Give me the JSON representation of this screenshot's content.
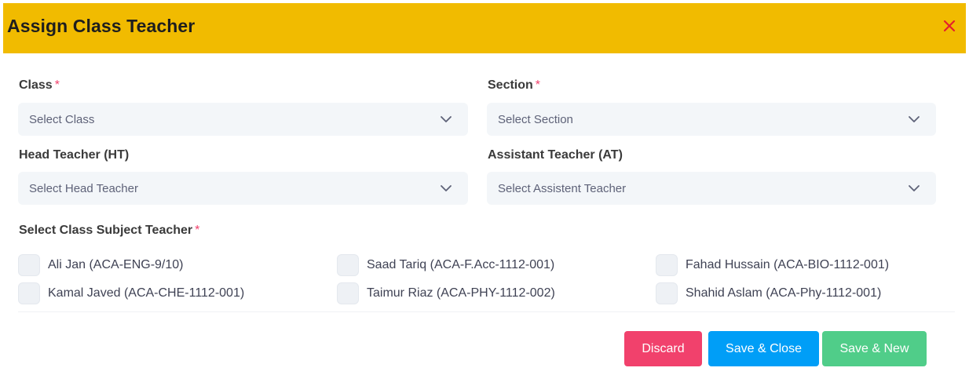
{
  "modal": {
    "title": "Assign Class Teacher",
    "close_icon": "close-icon",
    "accent_color": "#f1bb00",
    "close_color": "#e4202c"
  },
  "form": {
    "class": {
      "label": "Class",
      "required": "*",
      "placeholder": "Select Class"
    },
    "section": {
      "label": "Section",
      "required": "*",
      "placeholder": "Select Section"
    },
    "head_teacher": {
      "label": "Head Teacher (HT)",
      "placeholder": "Select Head Teacher"
    },
    "assistant_teacher": {
      "label": "Assistant Teacher (AT)",
      "placeholder": "Select Assistent Teacher"
    },
    "subject_teacher": {
      "label": "Select Class Subject Teacher",
      "required": "*",
      "options": [
        {
          "label": "Ali Jan (ACA-ENG-9/10)",
          "checked": false
        },
        {
          "label": "Saad Tariq (ACA-F.Acc-1112-001)",
          "checked": false
        },
        {
          "label": "Fahad Hussain (ACA-BIO-1112-001)",
          "checked": false
        },
        {
          "label": "Kamal Javed (ACA-CHE-1112-001)",
          "checked": false
        },
        {
          "label": "Taimur Riaz (ACA-PHY-1112-002)",
          "checked": false
        },
        {
          "label": "Shahid Aslam (ACA-Phy-1112-001)",
          "checked": false
        }
      ]
    }
  },
  "actions": {
    "discard": {
      "label": "Discard",
      "color": "#f1416c"
    },
    "save_close": {
      "label": "Save & Close",
      "color": "#009ef7"
    },
    "save_new": {
      "label": "Save & New",
      "color": "#50cd89"
    }
  }
}
